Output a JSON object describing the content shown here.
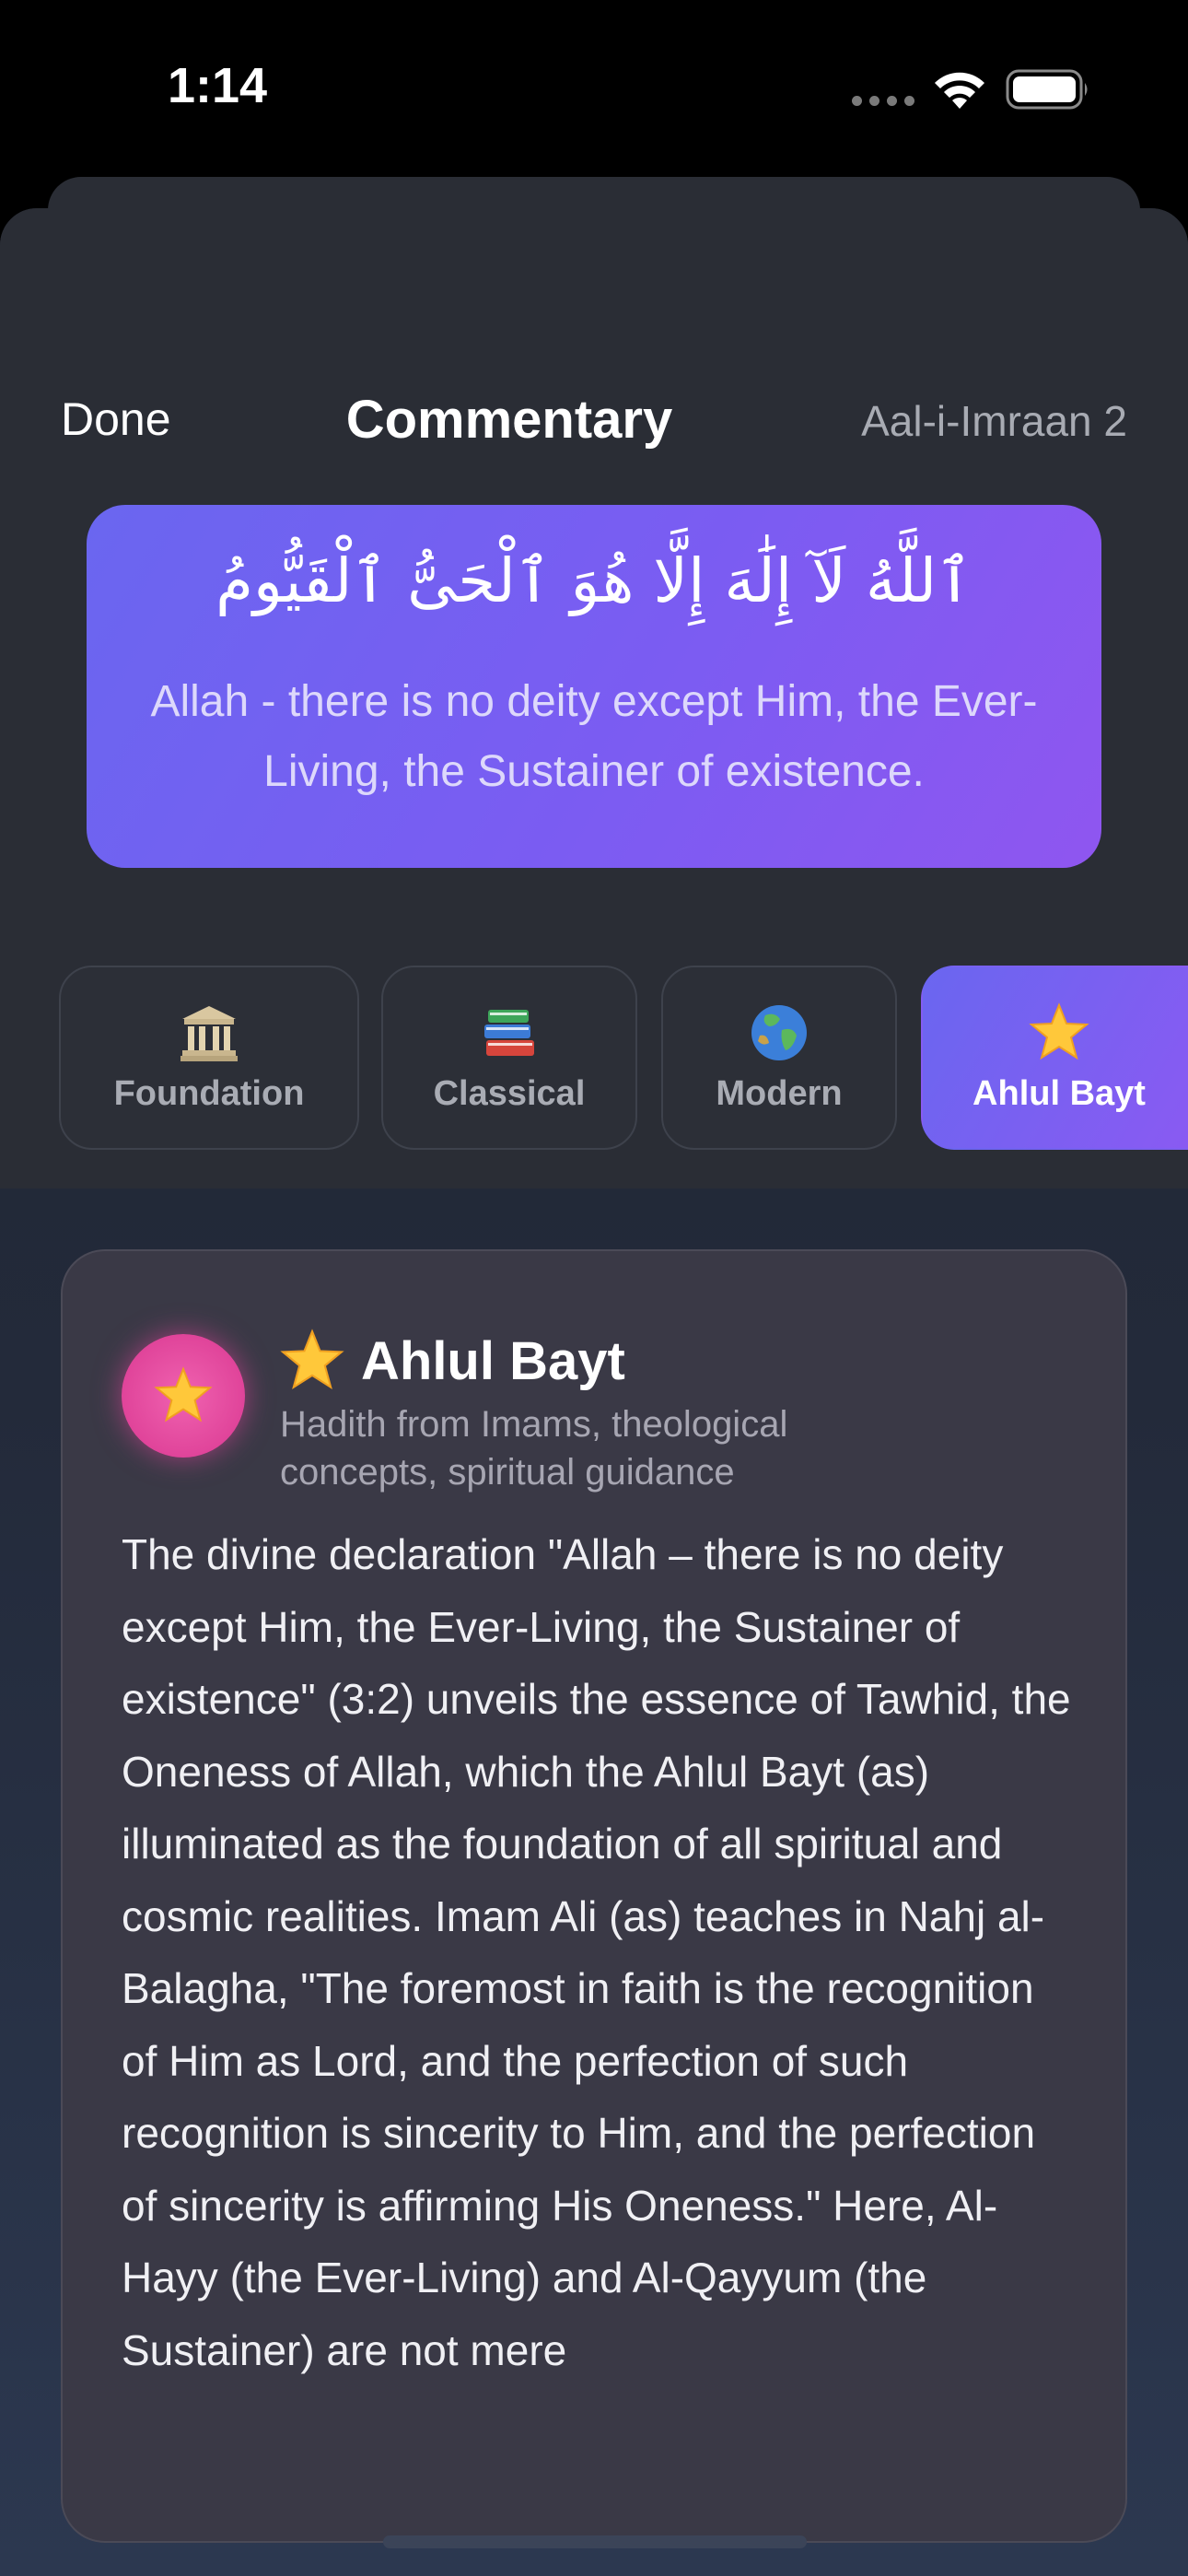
{
  "status_bar": {
    "time": "1:14"
  },
  "nav": {
    "done_label": "Done",
    "title": "Commentary",
    "reference": "Aal-i-Imraan 2"
  },
  "verse": {
    "arabic": "ٱللَّهُ لَآ إِلَٰهَ إِلَّا هُوَ ٱلْحَىُّ ٱلْقَيُّومُ",
    "translation": "Allah - there is no deity except Him, the Ever-Living, the Sustainer of existence."
  },
  "tabs": [
    {
      "label": "Foundation",
      "icon": "classical-building-icon",
      "active": false
    },
    {
      "label": "Classical",
      "icon": "books-icon",
      "active": false
    },
    {
      "label": "Modern",
      "icon": "globe-icon",
      "active": false
    },
    {
      "label": "Ahlul Bayt",
      "icon": "star-icon",
      "active": true
    }
  ],
  "commentary": {
    "avatar_icon": "star-icon",
    "title_icon": "star-icon",
    "title": "Ahlul Bayt",
    "subtitle": "Hadith from Imams, theological concepts, spiritual guidance",
    "body": "The divine declaration \"Allah – there is no deity except Him, the Ever-Living, the Sustainer of existence\" (3:2) unveils the essence of Tawhid, the Oneness of Allah, which the Ahlul Bayt (as) illuminated as the foundation of all spiritual and cosmic realities. Imam Ali (as) teaches in Nahj al-Balagha, \"The foremost in faith is the recognition of Him as Lord, and the perfection of such recognition is sincerity to Him, and the perfection of sincerity is affirming His Oneness.\" Here, Al-Hayy (the Ever-Living) and Al-Qayyum (the Sustainer) are not mere"
  },
  "colors": {
    "accent_gradient_start": "#6a66f0",
    "accent_gradient_end": "#8f56f0",
    "avatar": "#e0449a",
    "card_background": "#3a3946"
  }
}
